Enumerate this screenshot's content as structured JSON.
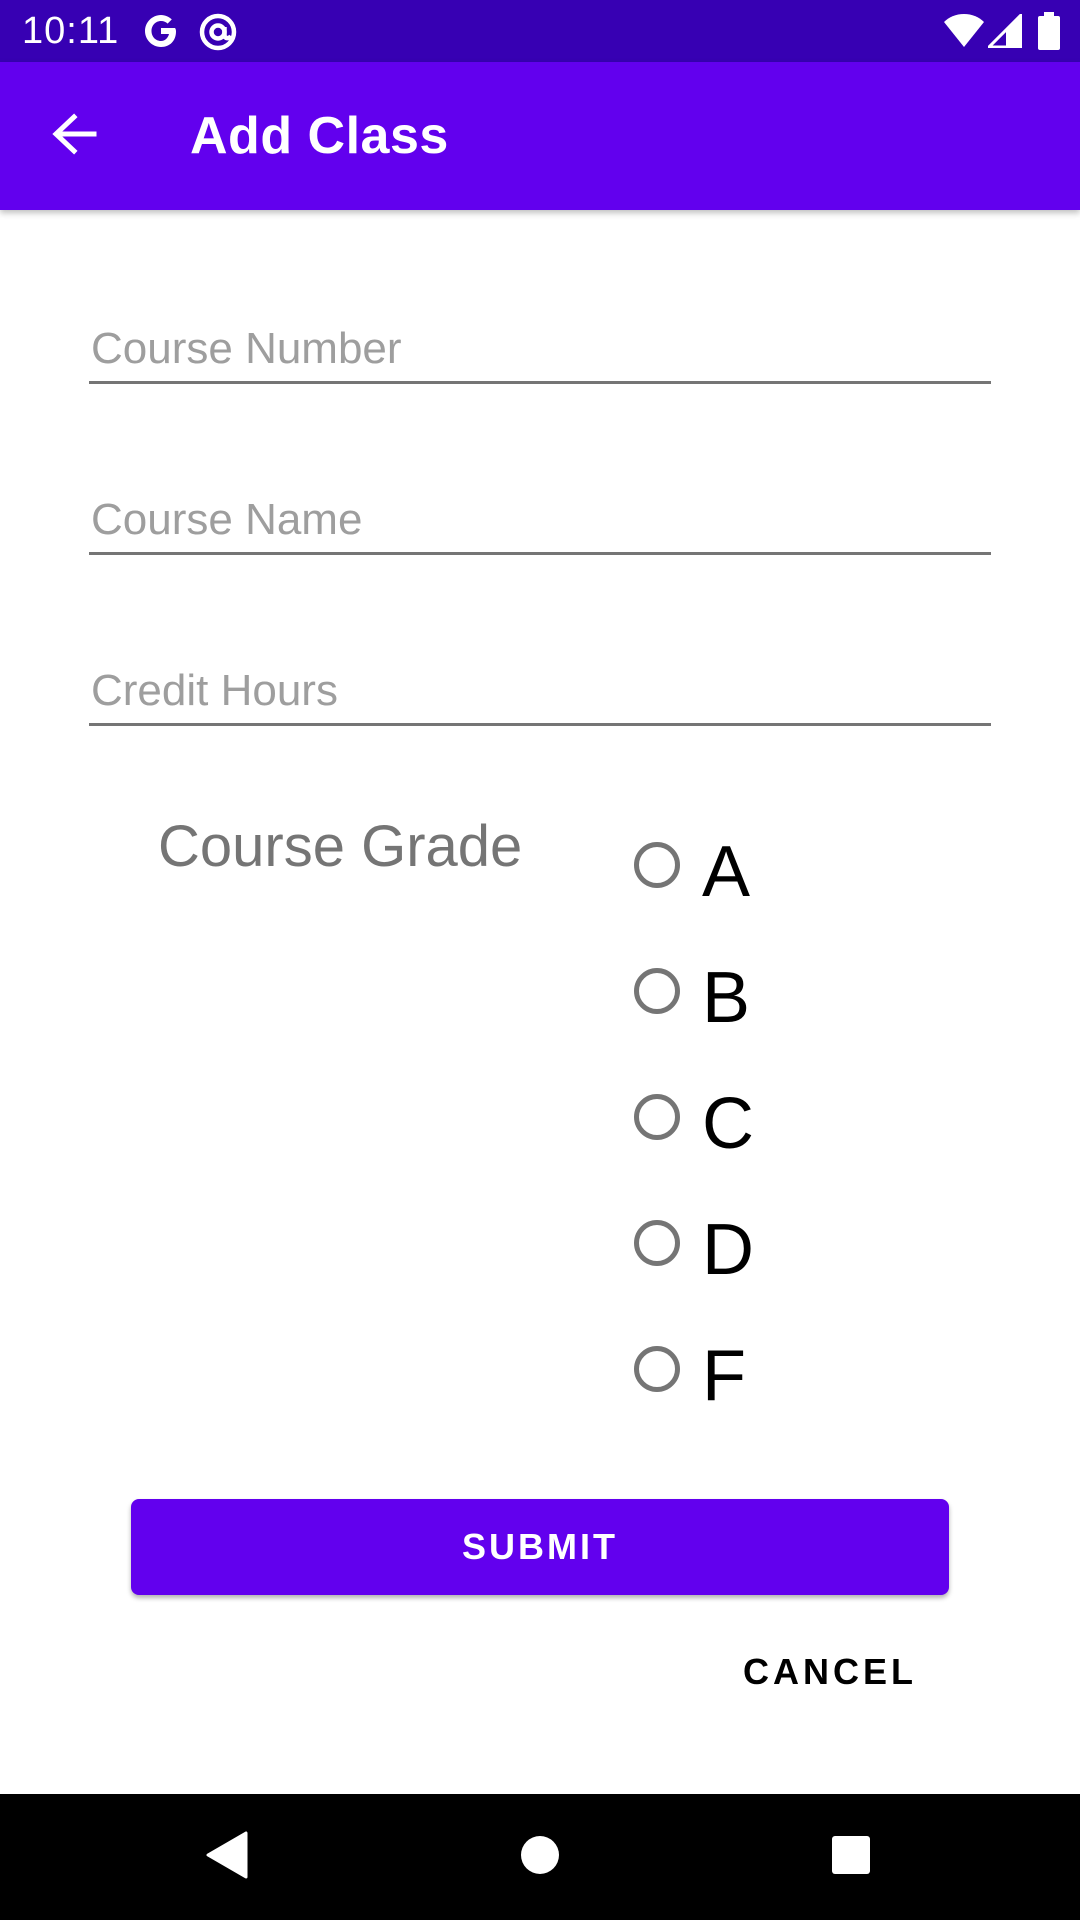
{
  "status_bar": {
    "time": "10:11",
    "icons": [
      "google-icon",
      "at-sign-icon",
      "wifi-icon",
      "signal-icon",
      "battery-icon"
    ]
  },
  "app_bar": {
    "title": "Add Class",
    "back_icon": "arrow-left-icon",
    "color": "#6200ee",
    "status_color": "#3700b3"
  },
  "form": {
    "course_number": {
      "value": "",
      "placeholder": "Course Number"
    },
    "course_name": {
      "value": "",
      "placeholder": "Course Name"
    },
    "credit_hours": {
      "value": "",
      "placeholder": "Credit Hours"
    },
    "grade": {
      "label": "Course Grade",
      "options": [
        "A",
        "B",
        "C",
        "D",
        "F"
      ],
      "selected": null
    }
  },
  "actions": {
    "submit_label": "SUBMIT",
    "cancel_label": "CANCEL"
  },
  "nav_bar": {
    "buttons": [
      "back-triangle-icon",
      "home-circle-icon",
      "recents-square-icon"
    ]
  }
}
